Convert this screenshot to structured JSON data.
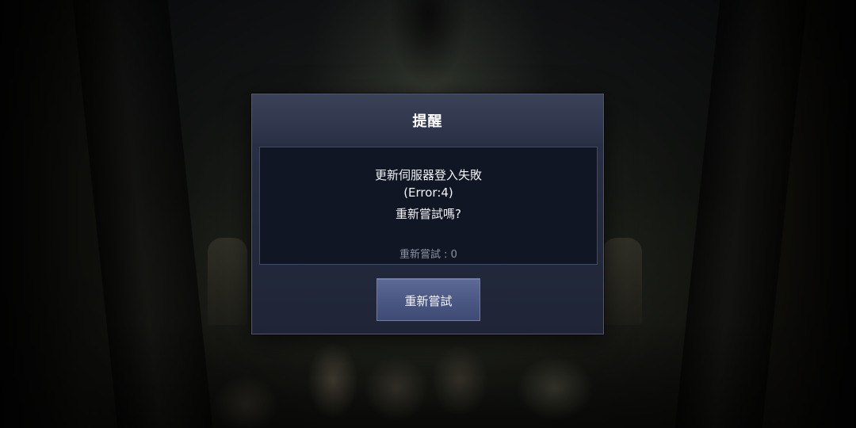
{
  "dialog": {
    "title": "提醒",
    "message": {
      "line1": "更新伺服器登入失敗",
      "line2": "(Error:4)",
      "line3": "重新嘗試嗎?"
    },
    "retry_count_text": "重新嘗試 : 0",
    "retry_button_label": "重新嘗試"
  },
  "colors": {
    "dialog_bg": "#232a3d",
    "message_bg": "#101624",
    "button_bg": "#4a5782",
    "text_primary": "#f2f3f6",
    "text_muted": "#8d93a3"
  }
}
